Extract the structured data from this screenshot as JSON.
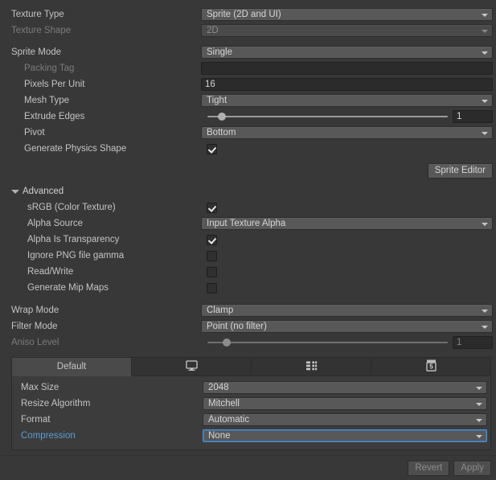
{
  "colors": {
    "background": "#383838",
    "field": "#585858",
    "input": "#2b2b2b",
    "accent_blue": "#5a9fd4",
    "focus_border": "#4b8fd0",
    "text": "#c4c4c4",
    "text_disabled": "#7b7b7b"
  },
  "rows": {
    "texture_type": {
      "label": "Texture Type",
      "value": "Sprite (2D and UI)"
    },
    "texture_shape": {
      "label": "Texture Shape",
      "value": "2D"
    },
    "sprite_mode": {
      "label": "Sprite Mode",
      "value": "Single"
    },
    "packing_tag": {
      "label": "Packing Tag",
      "value": ""
    },
    "pixels_per_unit": {
      "label": "Pixels Per Unit",
      "value": "16"
    },
    "mesh_type": {
      "label": "Mesh Type",
      "value": "Tight"
    },
    "extrude_edges": {
      "label": "Extrude Edges",
      "value": "1",
      "slider_percent": 6
    },
    "pivot": {
      "label": "Pivot",
      "value": "Bottom"
    },
    "generate_physics_shape": {
      "label": "Generate Physics Shape",
      "checked": true
    },
    "srgb": {
      "label": "sRGB (Color Texture)",
      "checked": true
    },
    "alpha_source": {
      "label": "Alpha Source",
      "value": "Input Texture Alpha"
    },
    "alpha_is_transparency": {
      "label": "Alpha Is Transparency",
      "checked": true
    },
    "ignore_png_gamma": {
      "label": "Ignore PNG file gamma",
      "checked": false
    },
    "read_write": {
      "label": "Read/Write",
      "checked": false
    },
    "generate_mip_maps": {
      "label": "Generate Mip Maps",
      "checked": false
    },
    "wrap_mode": {
      "label": "Wrap Mode",
      "value": "Clamp"
    },
    "filter_mode": {
      "label": "Filter Mode",
      "value": "Point (no filter)"
    },
    "aniso_level": {
      "label": "Aniso Level",
      "value": "1",
      "slider_percent": 8
    }
  },
  "advanced": {
    "label": "Advanced",
    "expanded": true
  },
  "sprite_editor": {
    "label": "Sprite Editor"
  },
  "platform_settings": {
    "tabs": [
      {
        "label": "Default",
        "icon": "",
        "icon_name": "none",
        "active": true
      },
      {
        "label": "",
        "icon": "",
        "icon_name": "standalone-monitor-icon",
        "active": false
      },
      {
        "label": "",
        "icon": "",
        "icon_name": "android-icon",
        "active": false
      },
      {
        "label": "",
        "icon": "",
        "icon_name": "webgl-html5-icon",
        "active": false
      }
    ],
    "rows": {
      "max_size": {
        "label": "Max Size",
        "value": "2048"
      },
      "resize_algorithm": {
        "label": "Resize Algorithm",
        "value": "Mitchell"
      },
      "format": {
        "label": "Format",
        "value": "Automatic"
      },
      "compression": {
        "label": "Compression",
        "value": "None",
        "focused": true
      }
    }
  },
  "footer": {
    "revert": "Revert",
    "apply": "Apply"
  }
}
